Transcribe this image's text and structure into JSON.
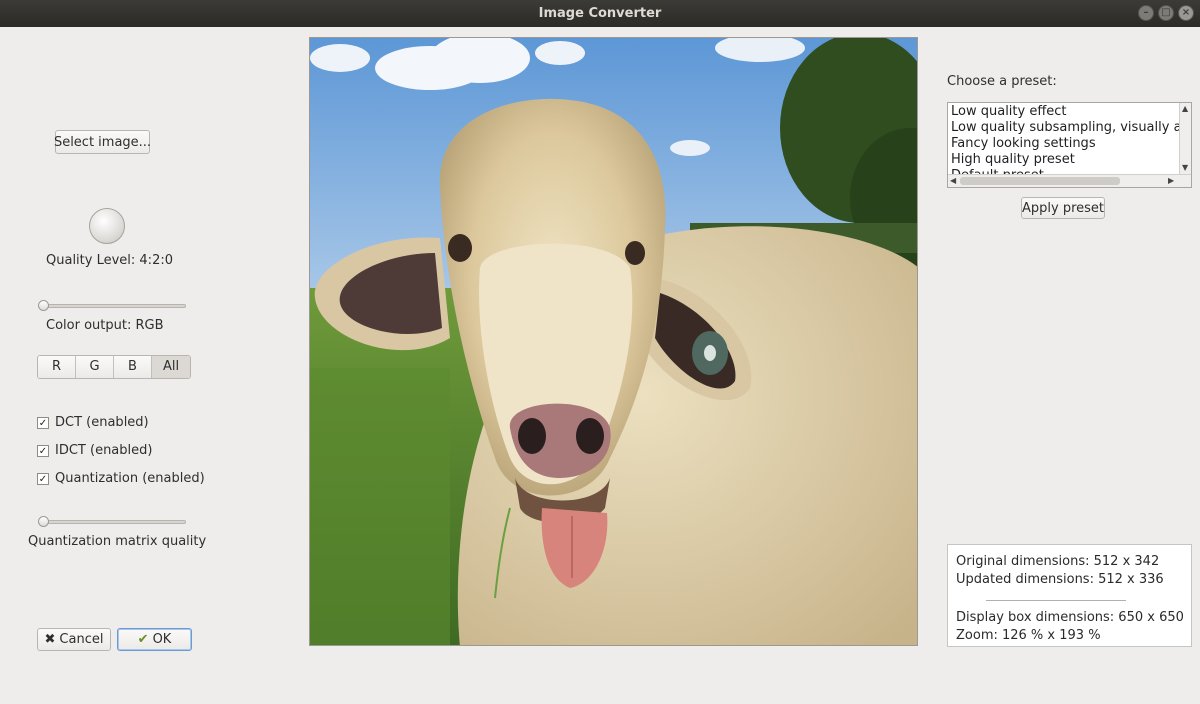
{
  "window": {
    "title": "Image Converter",
    "controls": [
      "minimize-icon",
      "maximize-icon",
      "close-icon"
    ]
  },
  "left_panel": {
    "select_image_label": "Select image...",
    "quality_label": "Quality Level: 4:2:0",
    "color_output_label": "Color output: RGB",
    "channels": [
      "R",
      "G",
      "B",
      "All"
    ],
    "selected_channel": "All",
    "checks": {
      "dct": "DCT (enabled)",
      "idct": "IDCT (enabled)",
      "quantization": "Quantization (enabled)"
    },
    "quant_matrix_label": "Quantization matrix quality",
    "cancel_label": "Cancel",
    "ok_label": "OK"
  },
  "right_panel": {
    "preset_label": "Choose a preset:",
    "presets": [
      "Low quality effect",
      "Low quality subsampling, visually ac",
      "Fancy looking settings",
      "High quality preset",
      "Default preset"
    ],
    "apply_label": "Apply preset",
    "info": {
      "original": "Original dimensions: 512 x 342",
      "updated": "Updated dimensions: 512 x 336",
      "display": "Display box dimensions: 650 x 650",
      "zoom": "Zoom: 126 % x 193 %"
    }
  },
  "colors": {
    "window_bg": "#efedeb",
    "titlebar": "#3c3b37",
    "ok_focus": "#6a9bd3"
  }
}
